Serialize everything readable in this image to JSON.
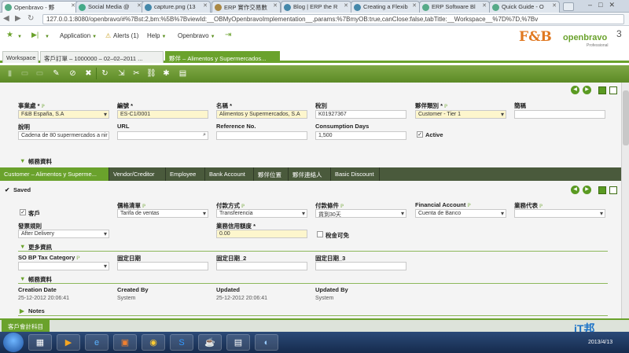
{
  "browser": {
    "tabs": [
      {
        "label": "Openbravo - 夥"
      },
      {
        "label": "Social Media @"
      },
      {
        "label": "capture.png (13"
      },
      {
        "label": "ERP 實作交易數"
      },
      {
        "label": "Blog | ERP the R"
      },
      {
        "label": "Creating a Flexib"
      },
      {
        "label": "ERP Software Bl"
      },
      {
        "label": "Quick Guide - O"
      }
    ],
    "url": "127.0.0.1:8080/openbravo/#%7Bst:2,bm:%5B%7BviewId:__OBMyOpenbravoImplementation__,params:%7BmyOB:true,canClose:false,tabTitle:__Workspace__%7D%7D,%7Bv"
  },
  "menu": {
    "application": "Application",
    "alerts": "Alerts (1)",
    "help": "Help",
    "openbravo": "Openbravo"
  },
  "logo": {
    "fnb": "F&B",
    "openbravo": "openbravo",
    "suffix": "3",
    "edition": "Professional"
  },
  "app_tabs": [
    "Workspace",
    "客戶訂單 – 1000000 – 02–02–2011 ...",
    "夥伴 – Alimentos y Supermercados..."
  ],
  "form": {
    "org_label": "事業處",
    "org_value": "F&B España, S.A",
    "code_label": "編號",
    "code_value": "ES-C1/0001",
    "name_label": "名稱",
    "name_value": "Alimentos y Supermercados, S.A",
    "tax_label": "稅別",
    "tax_value": "K01927367",
    "cat_label": "夥伴類別",
    "cat_value": "Customer - Tier 1",
    "desc2_label": "簡稱",
    "desc_label": "說明",
    "desc_value": "Cadena de 80 supermercados a nir",
    "url_label": "URL",
    "ref_label": "Reference No.",
    "cons_label": "Consumption Days",
    "cons_value": "1,500",
    "active_label": "Active",
    "more": "帳務資料"
  },
  "sub_tabs": [
    "Customer – Alimentos y Superme...",
    "Vendor/Creditor",
    "Employee",
    "Bank Account",
    "夥伴位置",
    "夥伴連絡人",
    "Basic Discount"
  ],
  "customer": {
    "saved": "Saved",
    "customer_label": "客戶",
    "pricelist_label": "價格清單",
    "pricelist_value": "Tarifa de ventas",
    "paymethod_label": "付款方式",
    "paymethod_value": "Transferencia",
    "payterm_label": "付款條件",
    "payterm_value": "貨到30天",
    "finacct_label": "Financial Account",
    "finacct_value": "Cuenta de Banco",
    "salesrep_label": "業務代表",
    "invoice_label": "發票規則",
    "invoice_value": "After Delivery",
    "credit_label": "業務信用額度",
    "credit_value": "0.00",
    "taxexempt_label": "稅金可免",
    "more_info": "更多資訊",
    "sotax_label": "SO BP Tax Category",
    "fixed1": "固定日期",
    "fixed2": "固定日期_2",
    "fixed3": "固定日期_3",
    "audit": "帳務資料",
    "creation_date_label": "Creation Date",
    "creation_date": "25-12-2012 20:06:41",
    "created_by_label": "Created By",
    "created_by": "System",
    "updated_label": "Updated",
    "updated": "25-12-2012 20:06:41",
    "updated_by_label": "Updated By",
    "updated_by": "System",
    "notes": "Notes"
  },
  "footer_tab": "客戶會計科目",
  "taskbar": {
    "date": "2013/4/13"
  },
  "watermark": "iT邦幫忙"
}
